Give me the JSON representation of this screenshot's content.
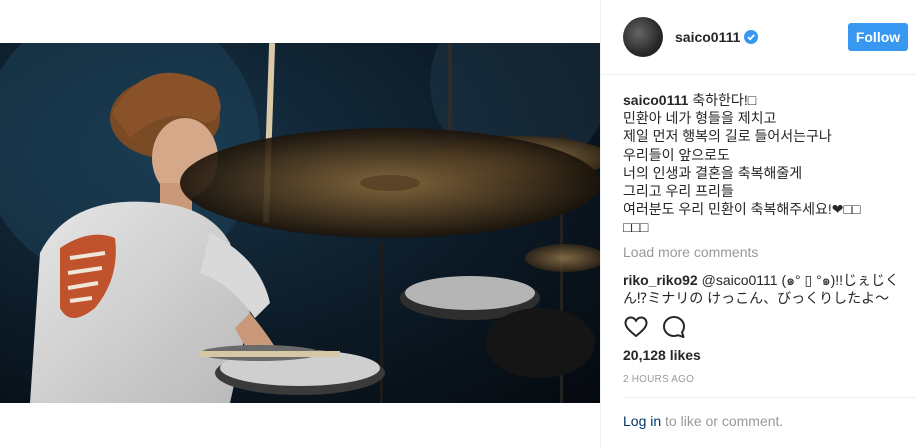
{
  "header": {
    "username": "saico0111",
    "follow_label": "Follow"
  },
  "caption": {
    "username": "saico0111",
    "lines": [
      "축하한다!□",
      "민환아 네가 형들을 제치고",
      "제일 먼저 행복의 길로 들어서는구나",
      "우리들이 앞으로도",
      "너의 인생과 결혼을 축복해줄게",
      "그리고 우리 프리들",
      "여러분도 우리 민환이 축복해주세요!❤□□",
      "□□□"
    ]
  },
  "load_more": "Load more comments",
  "comment": {
    "username": "riko_riko92",
    "text": "@saico0111 (๑° ▯ °๑)!!じぇじくん⁉︎ミナリの けっこん、びっくりしたよ〜"
  },
  "likes": "20,128 likes",
  "timestamp": "2 HOURS AGO",
  "login": {
    "link": "Log in",
    "rest": " to like or comment."
  },
  "icons": {
    "user_tag": "user-tag-icon",
    "like": "heart-icon",
    "comment": "comment-icon",
    "verified": "verified-badge-icon"
  },
  "colors": {
    "follow_button": "#3897f0",
    "verified": "#3897f0",
    "muted": "#999999",
    "link": "#003569"
  }
}
